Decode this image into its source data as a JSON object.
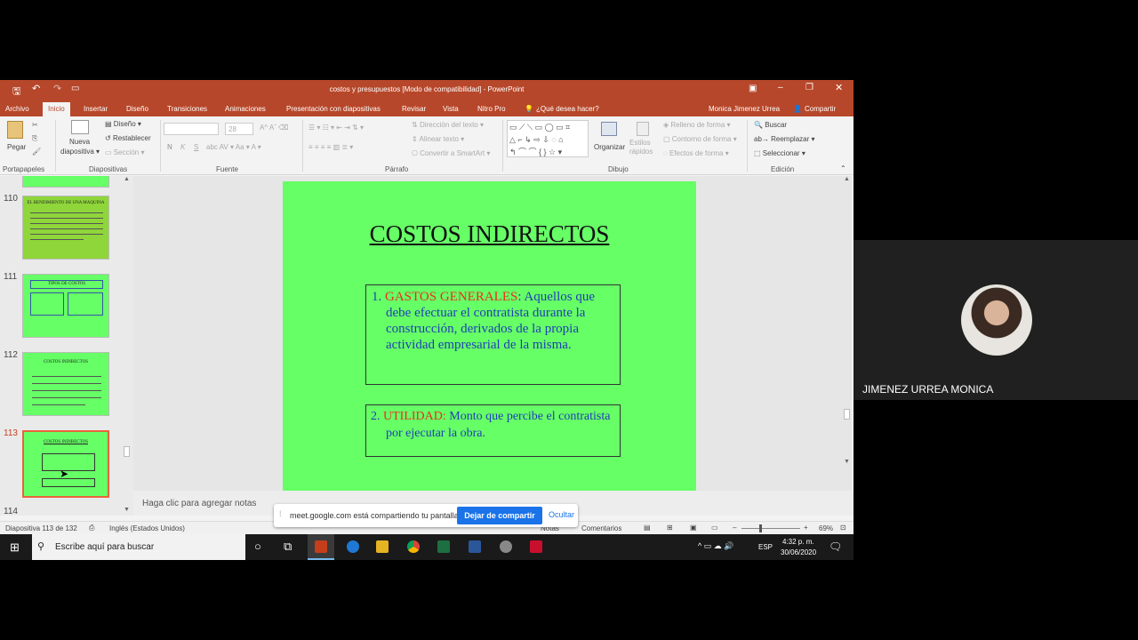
{
  "window": {
    "title": "costos y presupuestos [Modo de compatibilidad] - PowerPoint"
  },
  "tabs": [
    "Archivo",
    "Inicio",
    "Insertar",
    "Diseño",
    "Transiciones",
    "Animaciones",
    "Presentación con diapositivas",
    "Revisar",
    "Vista",
    "Nitro Pro"
  ],
  "tell_me": "¿Qué desea hacer?",
  "user": "Monica Jimenez Urrea",
  "share": "Compartir",
  "ribbon": {
    "paste": "Pegar",
    "new_slide": "Nueva diapositiva",
    "layout": "Diseño",
    "reset": "Restablecer",
    "section": "Sección",
    "font_size": "28",
    "text_direction": "Dirección del texto",
    "align_text": "Alinear texto",
    "smartart": "Convertir a SmartArt",
    "arrange": "Organizar",
    "quick_styles": "Estilos rápidos",
    "shape_fill": "Relleno de forma",
    "shape_outline": "Contorno de forma",
    "shape_effects": "Efectos de forma",
    "find": "Buscar",
    "replace": "Reemplazar",
    "select": "Seleccionar",
    "groups": [
      "Portapapeles",
      "Diapositivas",
      "Fuente",
      "Párrafo",
      "Dibujo",
      "Edición"
    ]
  },
  "thumbnails": [
    {
      "num": "110",
      "title": "EL RENDIMIENTO DE UNA MAQUINA"
    },
    {
      "num": "111",
      "title": "TIPOS DE COSTOS"
    },
    {
      "num": "112",
      "title": "COSTOS INDIRECTOS"
    },
    {
      "num": "113",
      "title": "COSTOS INDIRECTOS"
    },
    {
      "num": "114",
      "title": ""
    }
  ],
  "slide": {
    "title": "COSTOS INDIRECTOS",
    "item1_num": "1.",
    "item1_head": "GASTOS GENERALES",
    "item1_body": ": Aquellos que debe efectuar el contratista durante la construcción, derivados de la propia actividad empresarial de la misma.",
    "item2_num": "2.",
    "item2_head": "UTILIDAD:",
    "item2_body": " Monto que percibe el contratista por ejecutar la obra."
  },
  "notes_placeholder": "Haga clic para agregar notas",
  "status": {
    "slide_info": "Diapositiva 113 de 132",
    "language": "Inglés (Estados Unidos)",
    "comments": "Comentarios",
    "zoom": "69%"
  },
  "share_bar": {
    "message": "meet.google.com está compartiendo tu pantalla.",
    "stop": "Dejar de compartir",
    "hide": "Ocultar"
  },
  "taskbar": {
    "search": "Escribe aquí para buscar",
    "lang": "ESP",
    "time": "4:32 p. m.",
    "date": "30/06/2020"
  },
  "participant": {
    "name": "JIMENEZ URREA MONICA"
  }
}
